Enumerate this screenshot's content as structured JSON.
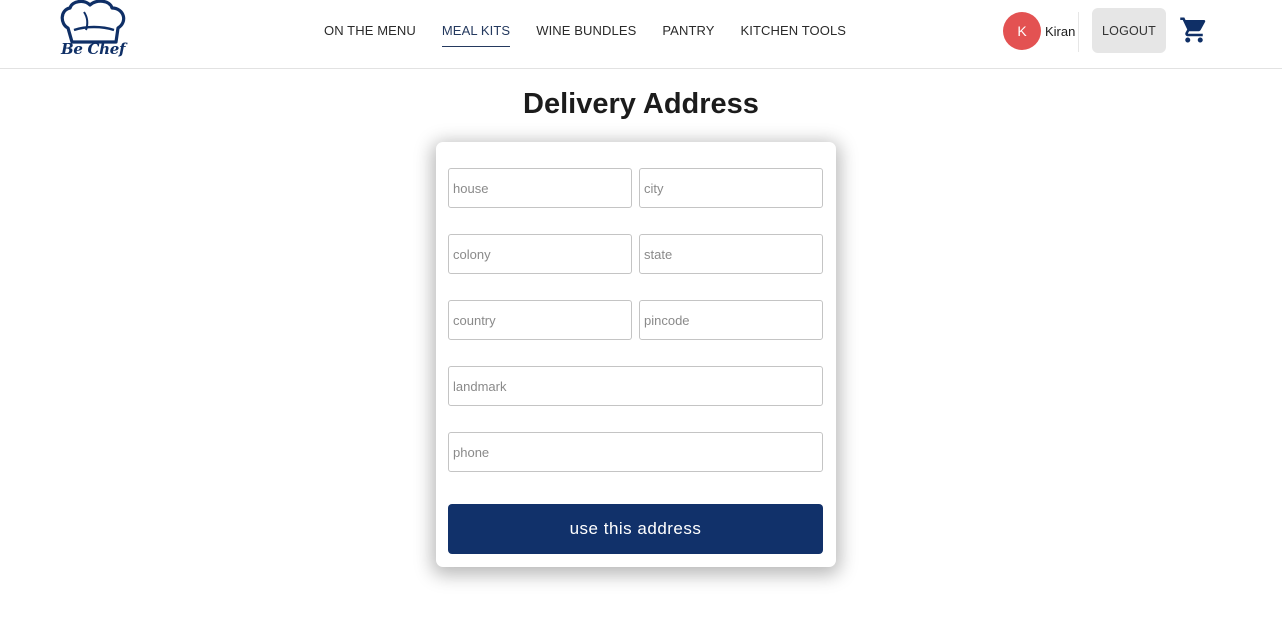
{
  "brand": {
    "name": "Be Chef",
    "color": "#0f2f66"
  },
  "nav": {
    "items": [
      {
        "label": "ON THE MENU"
      },
      {
        "label": "MEAL KITS",
        "active": true
      },
      {
        "label": "WINE BUNDLES"
      },
      {
        "label": "PANTRY"
      },
      {
        "label": "KITCHEN TOOLS"
      }
    ]
  },
  "user": {
    "initial": "K",
    "name": "Kiran",
    "avatar_color": "#e35252"
  },
  "header": {
    "logout_label": "LOGOUT",
    "cart_icon": "cart-icon"
  },
  "page": {
    "title": "Delivery Address"
  },
  "form": {
    "house_placeholder": "house",
    "city_placeholder": "city",
    "colony_placeholder": "colony",
    "state_placeholder": "state",
    "country_placeholder": "country",
    "pincode_placeholder": "pincode",
    "landmark_placeholder": "landmark",
    "phone_placeholder": "phone",
    "submit_label": "use this address",
    "submit_color": "#11316a"
  }
}
